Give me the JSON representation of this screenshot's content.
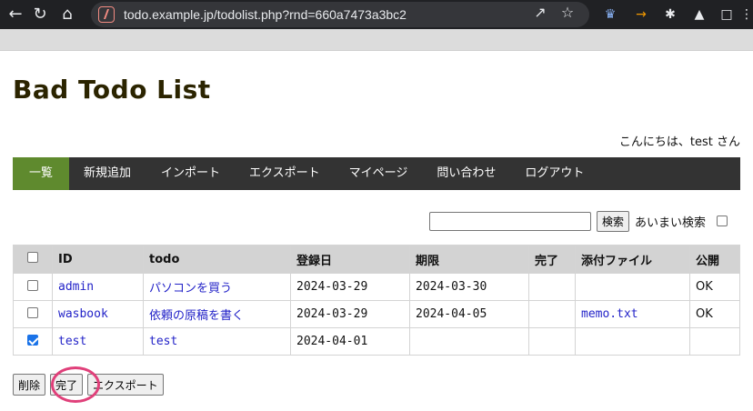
{
  "browser": {
    "url": "todo.example.jp/todolist.php?rnd=660a7473a3bc2",
    "back_icon": "arrow-left-icon",
    "reload_icon": "reload-icon",
    "home_icon": "home-icon",
    "share_icon": "share-icon",
    "bookmark_icon": "star-icon",
    "extensions_icon": "puzzle-icon",
    "accent": "#202124"
  },
  "page": {
    "title": "Bad Todo List",
    "greeting": "こんにちは、test さん"
  },
  "menu": {
    "items": [
      {
        "label": "一覧"
      },
      {
        "label": "新規追加"
      },
      {
        "label": "インポート"
      },
      {
        "label": "エクスポート"
      },
      {
        "label": "マイページ"
      },
      {
        "label": "問い合わせ"
      },
      {
        "label": "ログアウト"
      }
    ],
    "active_color": "#5f8a2e"
  },
  "search": {
    "input_value": "",
    "button_label": "検索",
    "fuzzy_label": "あいまい検索",
    "fuzzy_checked": false
  },
  "table": {
    "headers": [
      "ID",
      "todo",
      "登録日",
      "期限",
      "完了",
      "添付ファイル",
      "公開"
    ],
    "rows": [
      {
        "checked": false,
        "id": "admin",
        "todo": "パソコンを買う",
        "registered": "2024-03-29",
        "due": "2024-03-30",
        "done": "",
        "file": "",
        "public": "OK"
      },
      {
        "checked": false,
        "id": "wasbook",
        "todo": "依頼の原稿を書く",
        "registered": "2024-03-29",
        "due": "2024-04-05",
        "done": "",
        "file": "memo.txt",
        "public": "OK"
      },
      {
        "checked": true,
        "id": "test",
        "todo": "test",
        "registered": "2024-04-01",
        "due": "",
        "done": "",
        "file": "",
        "public": ""
      }
    ]
  },
  "actions": {
    "delete_label": "削除",
    "complete_label": "完了",
    "export_label": "エクスポート"
  },
  "highlight_color": "#e0407a"
}
